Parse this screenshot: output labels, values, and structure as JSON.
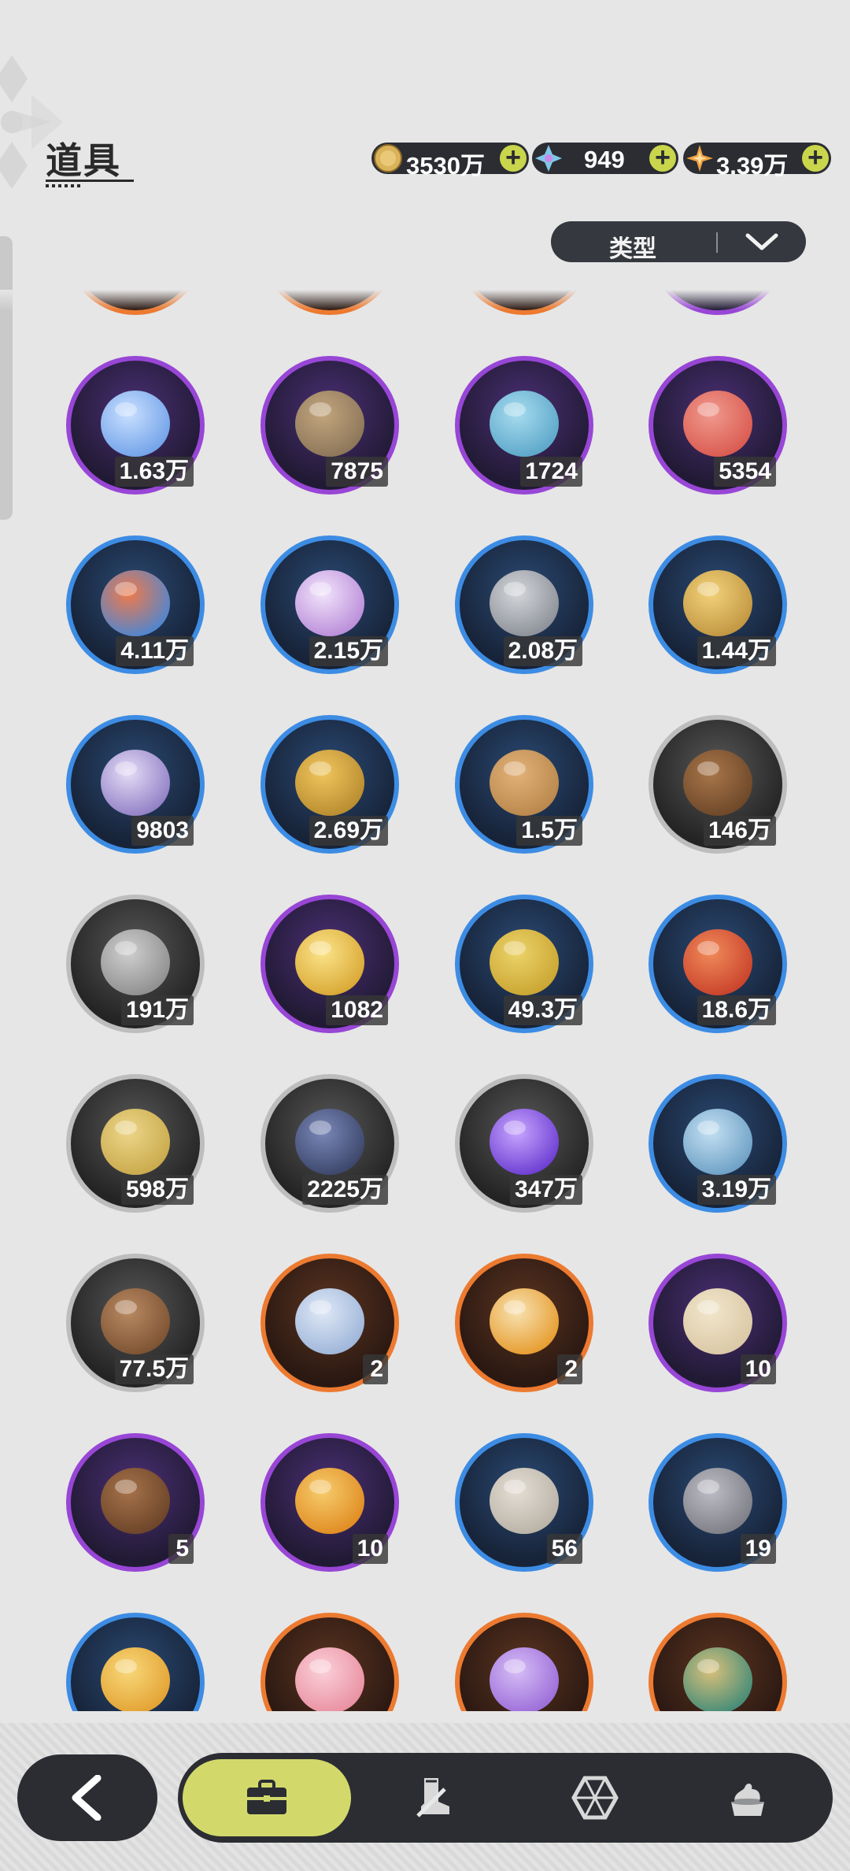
{
  "header": {
    "title": "道具",
    "currencies": [
      {
        "name": "gold-coin",
        "value": "3530万",
        "color": "#d9b25a"
      },
      {
        "name": "crystal",
        "value": "949",
        "color": "#7fc7e8"
      },
      {
        "name": "star-gem",
        "value": "3.39万",
        "color": "#f0a040"
      }
    ],
    "type_filter": {
      "label": "类型"
    }
  },
  "items": [
    {
      "icon": "star-moon-coin-icon",
      "rarity": "purple",
      "count": "1.63万"
    },
    {
      "icon": "fist-coin-icon",
      "rarity": "purple",
      "count": "7875"
    },
    {
      "icon": "blue-emblem-coin-icon",
      "rarity": "purple",
      "count": "1724"
    },
    {
      "icon": "heart-coin-icon",
      "rarity": "purple",
      "count": "5354"
    },
    {
      "icon": "sun-moon-medal-icon",
      "rarity": "blue",
      "count": "4.11万"
    },
    {
      "icon": "bunny-badge-icon",
      "rarity": "blue",
      "count": "2.15万"
    },
    {
      "icon": "silver-emblem-icon",
      "rarity": "blue",
      "count": "2.08万"
    },
    {
      "icon": "golden-blade-icon",
      "rarity": "blue",
      "count": "1.44万"
    },
    {
      "icon": "dragon-scale-icon",
      "rarity": "blue",
      "count": "9803"
    },
    {
      "icon": "gear-icon",
      "rarity": "blue",
      "count": "2.69万"
    },
    {
      "icon": "leaf-icon",
      "rarity": "blue",
      "count": "1.5万"
    },
    {
      "icon": "wood-logs-icon",
      "rarity": "gray",
      "count": "146万"
    },
    {
      "icon": "stone-bricks-icon",
      "rarity": "gray",
      "count": "191万"
    },
    {
      "icon": "gold-crystal-icon",
      "rarity": "purple",
      "count": "1082"
    },
    {
      "icon": "gold-nuggets-icon",
      "rarity": "blue",
      "count": "49.3万"
    },
    {
      "icon": "red-crystal-icon",
      "rarity": "blue",
      "count": "18.6万"
    },
    {
      "icon": "sand-pile-icon",
      "rarity": "gray",
      "count": "598万"
    },
    {
      "icon": "dark-crystal-icon",
      "rarity": "gray",
      "count": "2225万"
    },
    {
      "icon": "magic-orb-icon",
      "rarity": "gray",
      "count": "347万"
    },
    {
      "icon": "blue-feed-sack-icon",
      "rarity": "blue",
      "count": "3.19万"
    },
    {
      "icon": "brown-feed-sack-icon",
      "rarity": "gray",
      "count": "77.5万"
    },
    {
      "icon": "ribbon-bundle-icon",
      "rarity": "orange",
      "count": "2"
    },
    {
      "icon": "potion-bottle-icon",
      "rarity": "orange",
      "count": "2"
    },
    {
      "icon": "egg-icon",
      "rarity": "purple",
      "count": "10"
    },
    {
      "icon": "brown-twig-bundle-icon",
      "rarity": "purple",
      "count": "5"
    },
    {
      "icon": "orange-potion-icon",
      "rarity": "purple",
      "count": "10"
    },
    {
      "icon": "grey-egg-icon",
      "rarity": "blue",
      "count": "56"
    },
    {
      "icon": "grey-twig-bundle-icon",
      "rarity": "blue",
      "count": "19"
    },
    {
      "icon": "elixir-vial-icon",
      "rarity": "blue",
      "count": ""
    },
    {
      "icon": "pink-bouquet-icon",
      "rarity": "orange",
      "count": ""
    },
    {
      "icon": "purple-bouquet-icon",
      "rarity": "orange",
      "count": ""
    },
    {
      "icon": "pocket-watch-icon",
      "rarity": "orange",
      "count": ""
    }
  ],
  "top_partial_items": [
    {
      "rarity": "orange"
    },
    {
      "rarity": "orange"
    },
    {
      "rarity": "orange"
    },
    {
      "rarity": "purple"
    }
  ],
  "bottom_nav": {
    "back": {
      "icon": "back-arrow-icon"
    },
    "tabs": [
      {
        "icon": "briefcase-icon",
        "active": true
      },
      {
        "icon": "boot-sword-icon",
        "active": false
      },
      {
        "icon": "gem-hexagon-icon",
        "active": false
      },
      {
        "icon": "cream-pot-icon",
        "active": false
      }
    ]
  }
}
